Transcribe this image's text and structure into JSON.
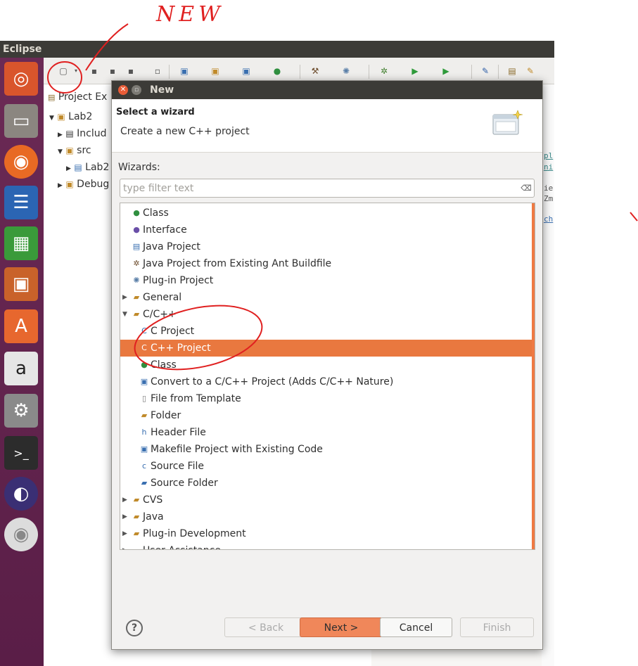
{
  "app_title": "Eclipse",
  "explorer": {
    "tab_label": "Project Ex",
    "tree": [
      "Lab2",
      "Includ",
      "src",
      "Lab2",
      "Debug"
    ]
  },
  "editor_fragments": [
    "pl",
    "ni",
    "ie",
    "Zm",
    "ch"
  ],
  "dialog": {
    "title": "New",
    "header_title": "Select a wizard",
    "header_desc": "Create a new C++ project",
    "wizards_label": "Wizards:",
    "filter_placeholder": "type filter text",
    "items": [
      {
        "label": "Class",
        "icon": "class-icon"
      },
      {
        "label": "Interface",
        "icon": "interface-icon"
      },
      {
        "label": "Java Project",
        "icon": "java-project-icon"
      },
      {
        "label": "Java Project from Existing Ant Buildfile",
        "icon": "ant-icon"
      },
      {
        "label": "Plug-in Project",
        "icon": "plugin-project-icon"
      },
      {
        "label": "General",
        "icon": "folder-icon"
      },
      {
        "label": "C/C++",
        "icon": "folder-icon"
      },
      {
        "label": "C Project",
        "icon": "c-project-icon"
      },
      {
        "label": "C++ Project",
        "icon": "cpp-project-icon"
      },
      {
        "label": "Class",
        "icon": "class-icon"
      },
      {
        "label": "Convert to a C/C++ Project (Adds C/C++ Nature)",
        "icon": "convert-icon"
      },
      {
        "label": "File from Template",
        "icon": "file-icon"
      },
      {
        "label": "Folder",
        "icon": "folder-icon"
      },
      {
        "label": "Header File",
        "icon": "header-file-icon"
      },
      {
        "label": "Makefile Project with Existing Code",
        "icon": "makefile-icon"
      },
      {
        "label": "Source File",
        "icon": "source-file-icon"
      },
      {
        "label": "Source Folder",
        "icon": "source-folder-icon"
      },
      {
        "label": "CVS",
        "icon": "folder-icon"
      },
      {
        "label": "Java",
        "icon": "folder-icon"
      },
      {
        "label": "Plug-in Development",
        "icon": "folder-icon"
      },
      {
        "label": "User Assistance",
        "icon": "folder-icon"
      }
    ],
    "selected_item": "C++ Project",
    "buttons": {
      "back": "< Back",
      "next": "Next >",
      "cancel": "Cancel",
      "finish": "Finish"
    },
    "help_glyph": "?"
  },
  "annotation_text": "NEW",
  "colors": {
    "accent": "#e9783f",
    "launcher": "#5a1e47",
    "titlebar": "#3c3b37",
    "annotation": "#e02020"
  }
}
